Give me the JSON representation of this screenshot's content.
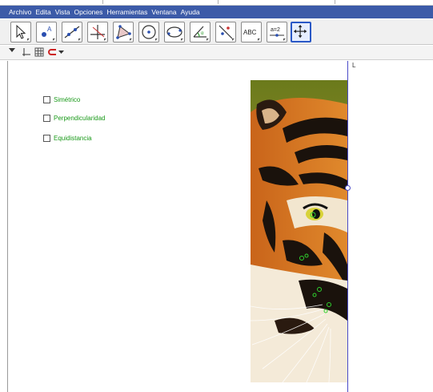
{
  "menu": [
    "Archivo",
    "Edita",
    "Vista",
    "Opciones",
    "Herramientas",
    "Ventana",
    "Ayuda"
  ],
  "toolbar": {
    "tools": [
      {
        "name": "move-tool-icon"
      },
      {
        "name": "point-tool-icon"
      },
      {
        "name": "line-tool-icon"
      },
      {
        "name": "perpendicular-tool-icon"
      },
      {
        "name": "polygon-tool-icon"
      },
      {
        "name": "circle-tool-icon"
      },
      {
        "name": "conic-tool-icon"
      },
      {
        "name": "angle-tool-icon"
      },
      {
        "name": "reflect-tool-icon"
      },
      {
        "name": "text-tool-icon",
        "label": "ABC"
      },
      {
        "name": "slider-tool-icon",
        "label": "a=2"
      },
      {
        "name": "move-graphics-view-icon",
        "selected": true
      }
    ]
  },
  "graphics": {
    "checkboxes": [
      {
        "label": "Simétrico",
        "checked": false
      },
      {
        "label": "Perpendicularidad",
        "checked": false
      },
      {
        "label": "Equidistancia",
        "checked": false
      }
    ],
    "line_label": "L"
  },
  "colors": {
    "menubar": "#3c5ba8",
    "checkbox_label": "#1a9a1a",
    "line": "#4a4ac8",
    "selected_tool": "#2a58c6"
  }
}
